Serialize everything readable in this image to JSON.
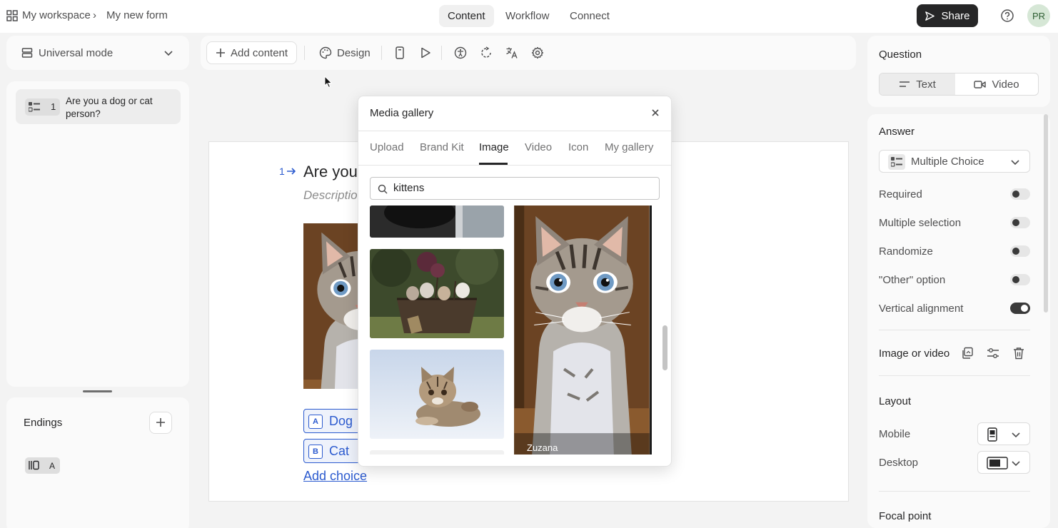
{
  "header": {
    "workspace": "My workspace",
    "form_name": "My new form",
    "tabs": [
      "Content",
      "Workflow",
      "Connect"
    ],
    "share_label": "Share",
    "avatar_initials": "PR"
  },
  "left_sidebar": {
    "mode_label": "Universal mode",
    "question_number": "1",
    "question_text": "Are you a dog or cat person?",
    "endings_title": "Endings",
    "ending_badge": "A"
  },
  "toolbar": {
    "add_content_label": "Add content",
    "design_label": "Design"
  },
  "canvas": {
    "question_number": "1",
    "question_title": "Are you a dog or cat person?",
    "description_placeholder": "Description (optional)",
    "choices": [
      {
        "key": "A",
        "label": "Dog"
      },
      {
        "key": "B",
        "label": "Cat"
      }
    ],
    "add_choice_label": "Add choice"
  },
  "media_gallery": {
    "title": "Media gallery",
    "tabs": [
      "Upload",
      "Brand Kit",
      "Image",
      "Video",
      "Icon",
      "My gallery"
    ],
    "active_tab": "Image",
    "search_value": "kittens",
    "hover_author": "Zuzana"
  },
  "right_panel": {
    "question_title": "Question",
    "question_types": [
      "Text",
      "Video"
    ],
    "answer_title": "Answer",
    "answer_type": "Multiple Choice",
    "toggles": [
      {
        "label": "Required",
        "on": false
      },
      {
        "label": "Multiple selection",
        "on": false
      },
      {
        "label": "Randomize",
        "on": false
      },
      {
        "label": "\"Other\" option",
        "on": false
      },
      {
        "label": "Vertical alignment",
        "on": true
      }
    ],
    "image_or_video_label": "Image or video",
    "layout_title": "Layout",
    "mobile_label": "Mobile",
    "desktop_label": "Desktop",
    "focal_point_title": "Focal point"
  },
  "colors": {
    "accent": "#2c5bcf",
    "dark": "#262627",
    "avatar_bg": "#d6e7d6"
  }
}
